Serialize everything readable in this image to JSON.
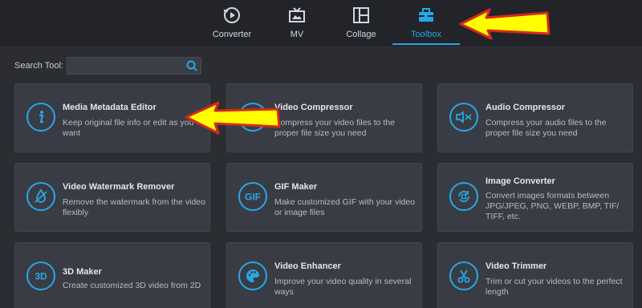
{
  "tabs": [
    {
      "label": "Converter",
      "icon": "converter-icon"
    },
    {
      "label": "MV",
      "icon": "mv-icon"
    },
    {
      "label": "Collage",
      "icon": "collage-icon"
    },
    {
      "label": "Toolbox",
      "icon": "toolbox-icon",
      "active": true
    }
  ],
  "search": {
    "label": "Search Tool:",
    "value": "",
    "placeholder": ""
  },
  "tools": [
    {
      "title": "Media Metadata Editor",
      "desc": "Keep original file info or edit as you want",
      "icon": "info-icon"
    },
    {
      "title": "Video Compressor",
      "desc": "Compress your video files to the proper file size you need",
      "icon": "compress-icon"
    },
    {
      "title": "Audio Compressor",
      "desc": "Compress your audio files to the proper file size you need",
      "icon": "audio-compress-icon"
    },
    {
      "title": "Video Watermark Remover",
      "desc": "Remove the watermark from the video flexibly",
      "icon": "watermark-icon"
    },
    {
      "title": "GIF Maker",
      "desc": "Make customized GIF with your video or image files",
      "icon": "gif-icon",
      "icon_text": "GIF"
    },
    {
      "title": "Image Converter",
      "desc": "Convert images formats between JPG/JPEG, PNG, WEBP, BMP, TIF/ TIFF, etc.",
      "icon": "image-convert-icon"
    },
    {
      "title": "3D Maker",
      "desc": "Create customized 3D video from 2D",
      "icon": "3d-icon",
      "icon_text": "3D"
    },
    {
      "title": "Video Enhancer",
      "desc": "Improve your video quality in several ways",
      "icon": "palette-icon"
    },
    {
      "title": "Video Trimmer",
      "desc": "Trim or cut your videos to the perfect length",
      "icon": "scissors-icon"
    }
  ],
  "colors": {
    "accent": "#27a7e6",
    "background": "#2b2d33",
    "card": "#393c44",
    "annotation_arrow": "#ffff00",
    "annotation_outline": "#d42a1e"
  }
}
